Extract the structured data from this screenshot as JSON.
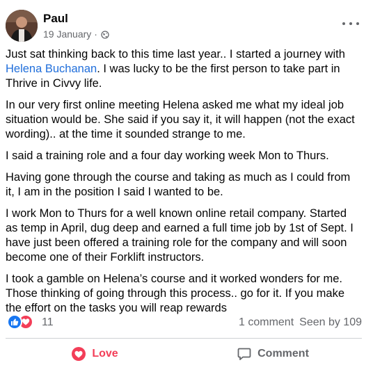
{
  "post": {
    "author": "Paul",
    "date": "19 January",
    "separator": "·",
    "privacy_icon": "globe-icon",
    "paragraphs": [
      {
        "before": "Just sat thinking back to this time last year.. I started a journey with ",
        "link": "Helena Buchanan",
        "after": ". I was lucky to be the first person to take part in Thrive in Civvy life."
      },
      {
        "text": "In our very first online meeting Helena asked me what my ideal job situation would be. She said if you say it, it will happen (not the exact wording).. at the time it sounded strange to me."
      },
      {
        "text": "I said a training role and a four day working week Mon to Thurs."
      },
      {
        "text": "Having gone through the course and taking as much as I could from it, I am in the position I said I wanted to be."
      },
      {
        "text": "I work Mon to Thurs for a well known online retail company. Started as temp in April, dug deep and earned a full time job by 1st of Sept. I have just been offered a training role for the company and will soon become one of their Forklift instructors."
      },
      {
        "text": "I took a gamble on Helena’s course and it worked wonders for me. Those thinking of going through this process.. go for it. If you make the effort on the tasks you will reap rewards"
      }
    ]
  },
  "stats": {
    "reaction_count": "11",
    "comments": "1 comment",
    "seen_by": "Seen by 109"
  },
  "actions": {
    "love_label": "Love",
    "comment_label": "Comment"
  },
  "colors": {
    "link": "#216fdb",
    "like": "#1877f2",
    "love": "#f33e58",
    "secondary_text": "#65676b"
  }
}
